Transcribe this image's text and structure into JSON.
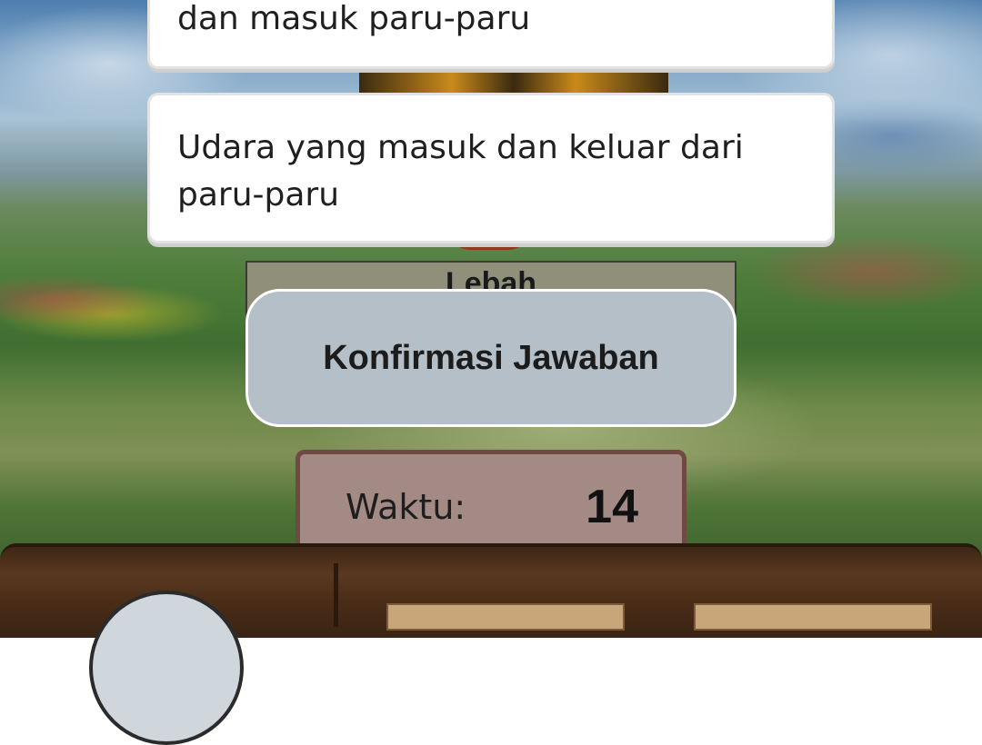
{
  "answers": [
    {
      "text": "dan masuk paru-paru"
    },
    {
      "text": "Udara yang masuk dan keluar dari paru-paru"
    }
  ],
  "question_label": "Lebah",
  "confirm_button": {
    "label": "Konfirmasi Jawaban"
  },
  "timer": {
    "label": "Waktu:",
    "value": "14"
  }
}
